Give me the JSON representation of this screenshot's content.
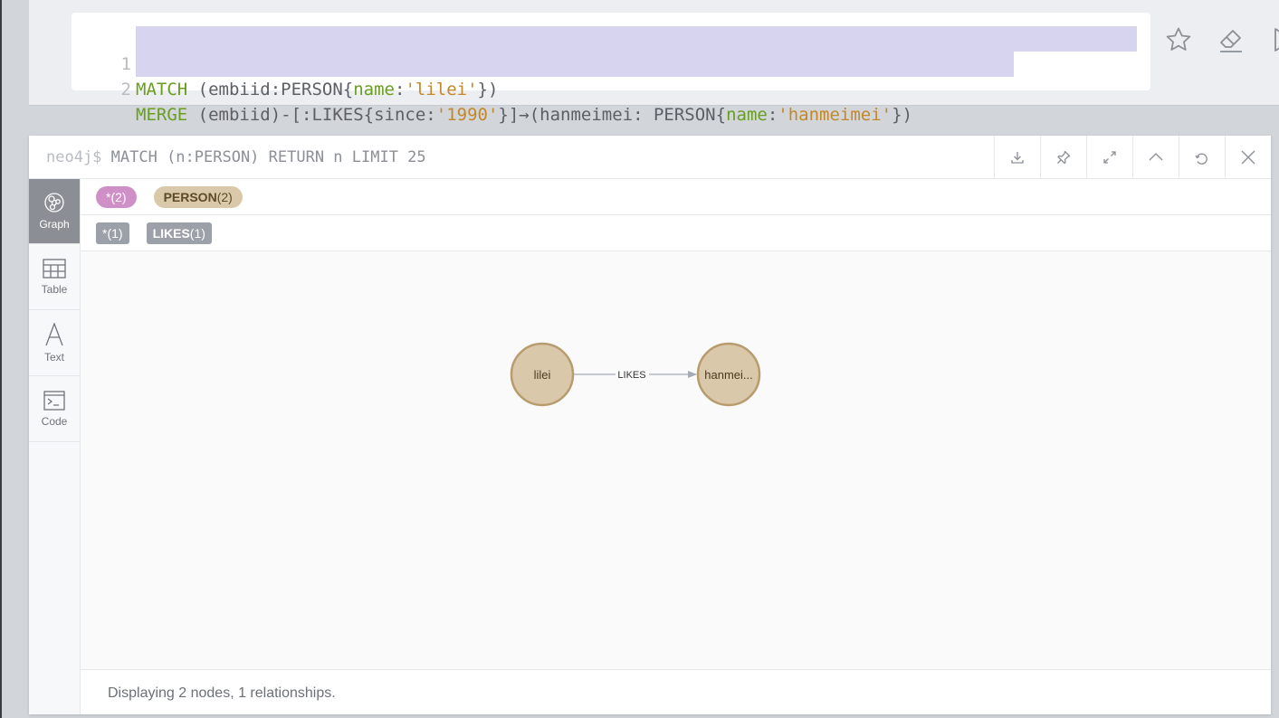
{
  "editor": {
    "lines": [
      {
        "number": "1",
        "parts": [
          {
            "t": "MATCH",
            "c": "kw"
          },
          {
            "t": " (embiid:PERSON{",
            "c": ""
          },
          {
            "t": "name",
            "c": "prop"
          },
          {
            "t": ":",
            "c": ""
          },
          {
            "t": "'lilei'",
            "c": "str"
          },
          {
            "t": "})",
            "c": ""
          }
        ]
      },
      {
        "number": "2",
        "parts": [
          {
            "t": "MERGE",
            "c": "kw"
          },
          {
            "t": " (embiid)-[:LIKES{since:",
            "c": ""
          },
          {
            "t": "'1990'",
            "c": "str"
          },
          {
            "t": "}]→(hanmeimei: PERSON{",
            "c": ""
          },
          {
            "t": "name",
            "c": "prop"
          },
          {
            "t": ":",
            "c": ""
          },
          {
            "t": "'hanmeimei'",
            "c": "str"
          },
          {
            "t": "})",
            "c": ""
          }
        ]
      }
    ],
    "actions": [
      "star-icon",
      "eraser-icon",
      "play-icon"
    ]
  },
  "frame": {
    "prompt": "neo4j$",
    "command": " MATCH (n:PERSON) RETURN n LIMIT 25",
    "actions": [
      "download-icon",
      "pin-icon",
      "expand-icon",
      "collapse-icon",
      "refresh-icon",
      "close-icon"
    ]
  },
  "sidebar": {
    "tabs": [
      {
        "label": "Graph",
        "icon": "graph-icon",
        "active": true
      },
      {
        "label": "Table",
        "icon": "table-icon",
        "active": false
      },
      {
        "label": "Text",
        "icon": "text-icon",
        "active": false
      },
      {
        "label": "Code",
        "icon": "code-icon",
        "active": false
      }
    ]
  },
  "legend": {
    "all_nodes": "*(2)",
    "person_label": "PERSON",
    "person_count": "(2)",
    "all_rels": "*(1)",
    "likes_label": "LIKES",
    "likes_count": "(1)"
  },
  "graph": {
    "nodes": [
      {
        "id": "lilei",
        "caption": "lilei"
      },
      {
        "id": "hanmeimei",
        "caption": "hanmei..."
      }
    ],
    "relationship": {
      "type": "LIKES"
    },
    "colors": {
      "node_fill": "#d9c8aa",
      "node_stroke": "#b89c6e",
      "rel_stroke": "#a5abb6"
    }
  },
  "status": "Displaying 2 nodes, 1 relationships."
}
